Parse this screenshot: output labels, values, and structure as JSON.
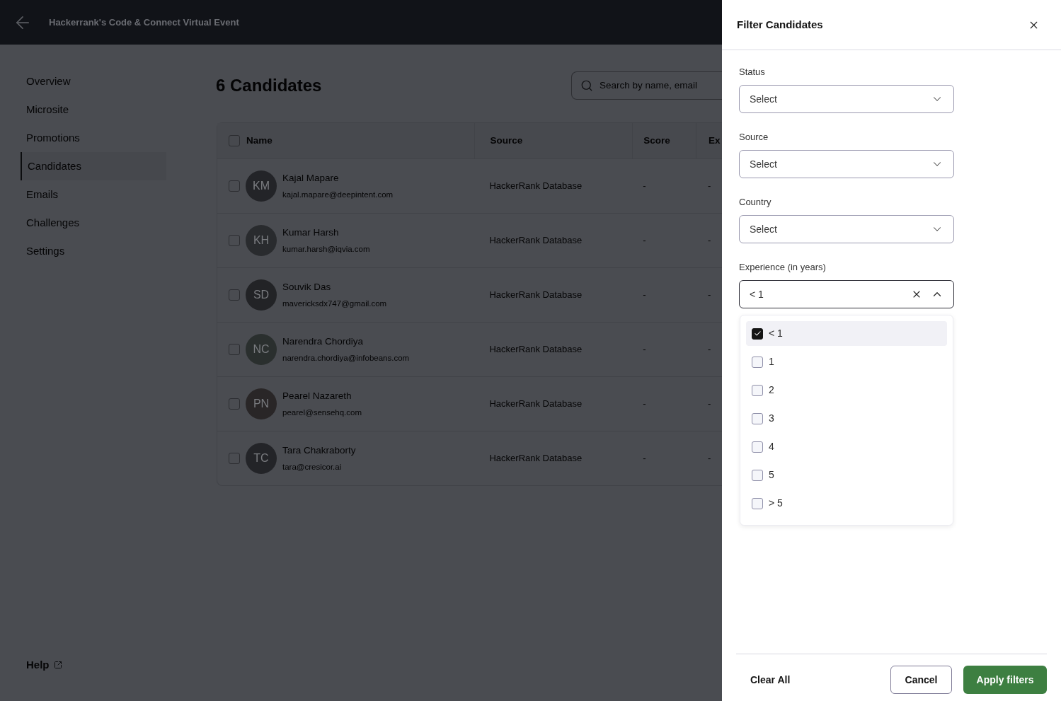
{
  "header": {
    "title": "Hackerrank's Code & Connect Virtual Event"
  },
  "sidebar": {
    "items": [
      {
        "label": "Overview",
        "selected": false
      },
      {
        "label": "Microsite",
        "selected": false
      },
      {
        "label": "Promotions",
        "selected": false
      },
      {
        "label": "Candidates",
        "selected": true
      },
      {
        "label": "Emails",
        "selected": false
      },
      {
        "label": "Challenges",
        "selected": false
      },
      {
        "label": "Settings",
        "selected": false
      }
    ],
    "help": "Help"
  },
  "main": {
    "heading": "6 Candidates",
    "search": {
      "placeholder": "Search by name, email"
    }
  },
  "table": {
    "select_all_checked": false,
    "columns": [
      "Name",
      "Source",
      "Score",
      "Ex"
    ],
    "rows": [
      {
        "checked": false,
        "initials": "KM",
        "color": "#232428",
        "name": "Kajal Mapare",
        "email": "kajal.mapare@deepintent.com",
        "source": "HackerRank Database",
        "score": "-",
        "column_4": "-"
      },
      {
        "checked": false,
        "initials": "KH",
        "color": "#292b2e",
        "name": "Kumar Harsh",
        "email": "kumar.harsh@iqvia.com",
        "source": "HackerRank Database",
        "score": "-",
        "column_4": "-"
      },
      {
        "checked": false,
        "initials": "SD",
        "color": "#222326",
        "name": "Souvik Das",
        "email": "mavericksdx747@gmail.com",
        "source": "HackerRank Database",
        "score": "-",
        "column_4": "-"
      },
      {
        "checked": false,
        "initials": "NC",
        "color": "#2a2f2e",
        "name": "Narendra Chordiya",
        "email": "narendra.chordiya@infobeans.com",
        "source": "HackerRank Database",
        "score": "-",
        "column_4": "-"
      },
      {
        "checked": false,
        "initials": "PN",
        "color": "#292627",
        "name": "Pearel Nazareth",
        "email": "pearel@sensehq.com",
        "source": "HackerRank Database",
        "score": "-",
        "column_4": "-"
      },
      {
        "checked": false,
        "initials": "TC",
        "color": "#232428",
        "name": "Tara Chakraborty",
        "email": "tara@cresicor.ai",
        "source": "HackerRank Database",
        "score": "-",
        "column_4": "-"
      }
    ]
  },
  "filter_panel": {
    "title": "Filter Candidates",
    "fields": [
      {
        "label": "Status",
        "placeholder": "Select",
        "expanded": false
      },
      {
        "label": "Source",
        "placeholder": "Select",
        "expanded": false
      },
      {
        "label": "Country",
        "placeholder": "Select",
        "expanded": false
      },
      {
        "label": "Experience (in years)",
        "value": "< 1",
        "expanded": true,
        "options": [
          {
            "label": "< 1",
            "checked": true,
            "highlighted": true
          },
          {
            "label": "1",
            "checked": false,
            "highlighted": false
          },
          {
            "label": "2",
            "checked": false,
            "highlighted": false
          },
          {
            "label": "3",
            "checked": false,
            "highlighted": false
          },
          {
            "label": "4",
            "checked": false,
            "highlighted": false
          },
          {
            "label": "5",
            "checked": false,
            "highlighted": false
          },
          {
            "label": "> 5",
            "checked": false,
            "highlighted": false
          }
        ]
      }
    ],
    "buttons": {
      "clear": "Clear All",
      "cancel": "Cancel",
      "apply": "Apply filters"
    }
  }
}
